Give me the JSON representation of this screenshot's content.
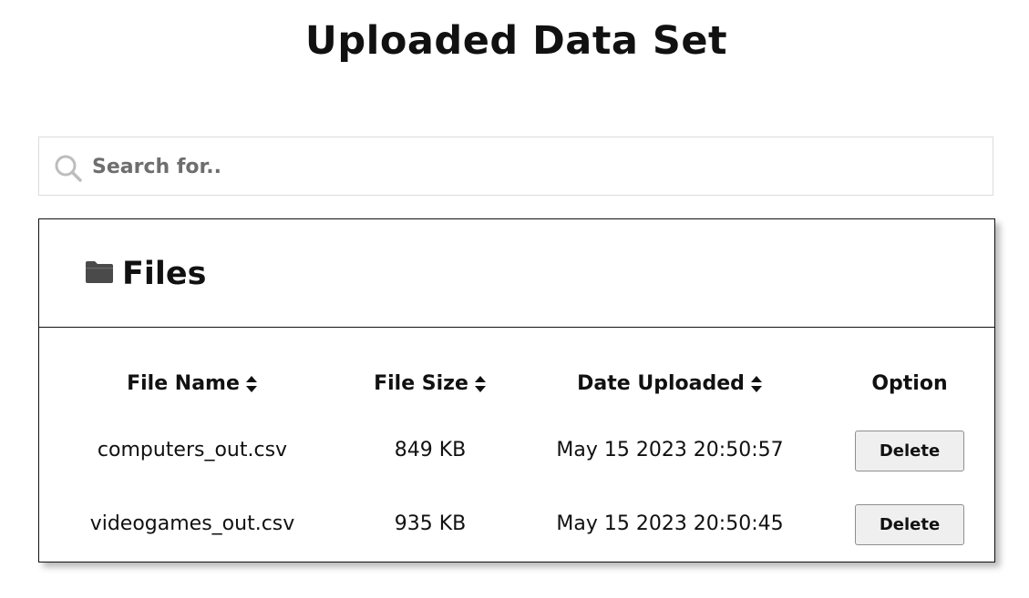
{
  "page": {
    "title": "Uploaded Data Set"
  },
  "search": {
    "placeholder": "Search for..",
    "value": "",
    "icon": "search-icon"
  },
  "files_panel": {
    "title": "Files",
    "icon": "folder-icon",
    "columns": [
      {
        "label": "File Name",
        "sortable": true
      },
      {
        "label": "File Size",
        "sortable": true
      },
      {
        "label": "Date Uploaded",
        "sortable": true
      },
      {
        "label": "Option",
        "sortable": false
      }
    ],
    "rows": [
      {
        "file_name": "computers_out.csv",
        "file_size": "849 KB",
        "date_uploaded": "May 15 2023 20:50:57",
        "option": "Delete"
      },
      {
        "file_name": "videogames_out.csv",
        "file_size": "935 KB",
        "date_uploaded": "May 15 2023 20:50:45",
        "option": "Delete"
      }
    ]
  },
  "colors": {
    "text": "#111111",
    "placeholder": "#6e6e6e",
    "search_border": "#dcdcdc",
    "button_bg": "#efefef",
    "button_border": "#8f8f8f",
    "icon_gray": "#bdbdbd",
    "folder": "#4a4a4a"
  }
}
